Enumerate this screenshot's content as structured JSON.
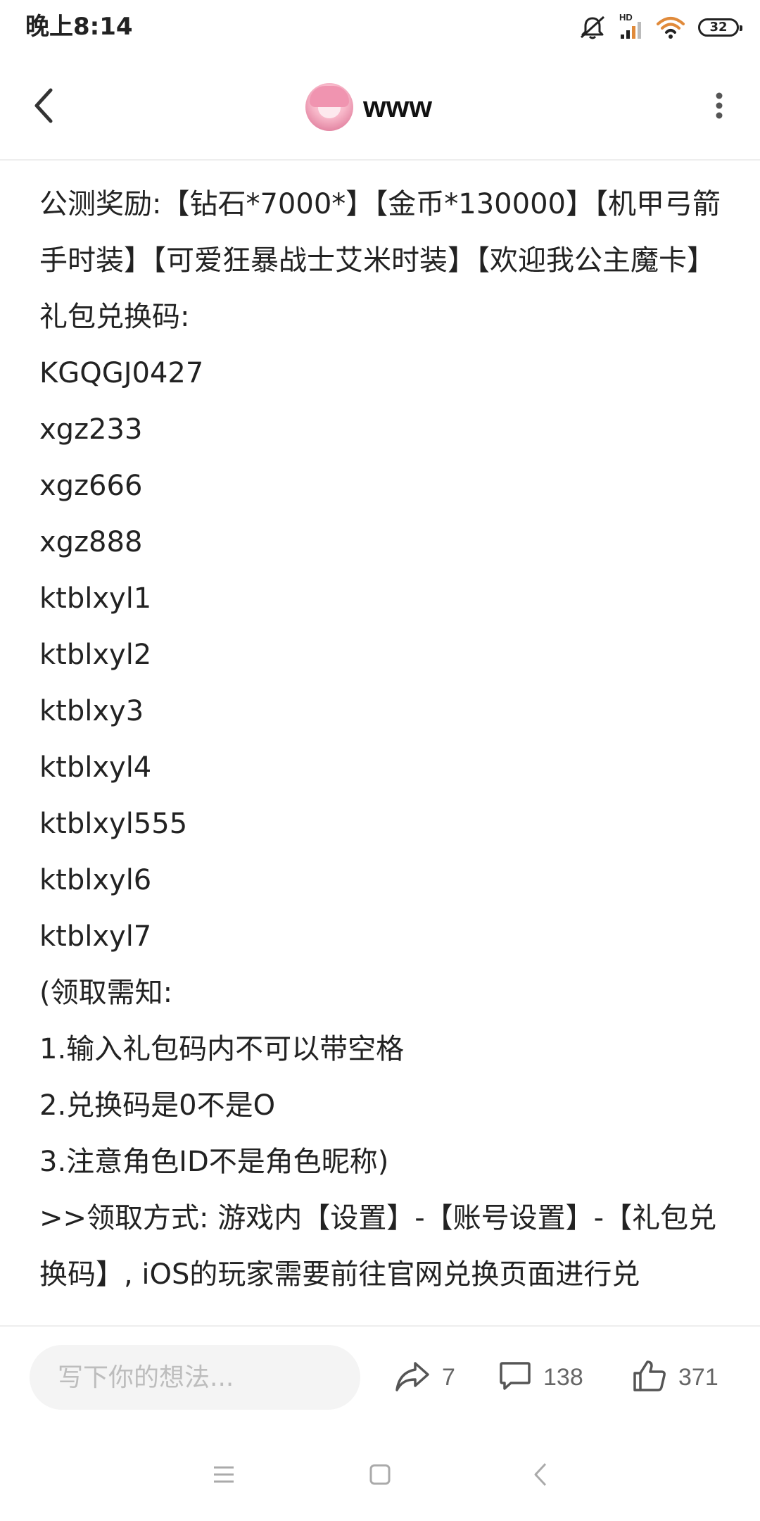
{
  "status_bar": {
    "time": "晚上8:14",
    "signal_label": "HD",
    "battery_level": "32"
  },
  "header": {
    "title": "www"
  },
  "article": {
    "lines": [
      "公测奖励:【钻石*7000*】【金币*130000】【机甲弓箭手时装】【可爱狂暴战士艾米时装】【欢迎我公主魔卡】",
      "礼包兑换码:",
      "KGQGJ0427",
      "xgz233",
      "xgz666",
      "xgz888",
      "ktblxyl1",
      "ktblxyl2",
      "ktblxy3",
      "ktblxyl4",
      "ktblxyl555",
      "ktblxyl6",
      "ktblxyl7",
      "(领取需知:",
      "1.输入礼包码内不可以带空格",
      "2.兑换码是0不是O",
      "3.注意角色ID不是角色昵称)",
      ">>领取方式: 游戏内【设置】-【账号设置】-【礼包兑换码】, iOS的玩家需要前往官网兑换页面进行兑"
    ]
  },
  "action_bar": {
    "comment_placeholder": "写下你的想法...",
    "share_count": "7",
    "comment_count": "138",
    "like_count": "371"
  },
  "icons": {
    "back": "back-arrow-icon",
    "more": "more-vertical-icon",
    "share": "share-icon",
    "comment": "comment-icon",
    "like": "thumbs-up-icon"
  },
  "colors": {
    "text": "#222222",
    "muted": "#666666",
    "placeholder": "#bdbdbd",
    "input_bg": "#f4f4f4",
    "divider": "#eeeeee"
  }
}
